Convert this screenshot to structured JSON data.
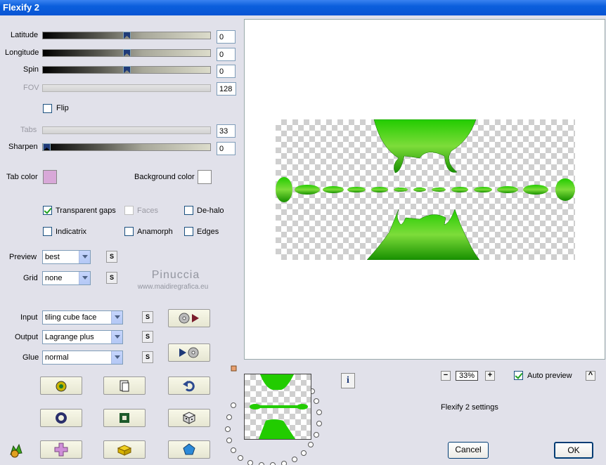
{
  "window": {
    "title": "Flexify 2"
  },
  "sliders": {
    "latitude": {
      "label": "Latitude",
      "value": "0",
      "position": 0.5
    },
    "longitude": {
      "label": "Longitude",
      "value": "0",
      "position": 0.5
    },
    "spin": {
      "label": "Spin",
      "value": "0",
      "position": 0.5
    },
    "fov": {
      "label": "FOV",
      "value": "128",
      "enabled": false
    },
    "tabs": {
      "label": "Tabs",
      "value": "33",
      "enabled": false
    },
    "sharpen": {
      "label": "Sharpen",
      "value": "0",
      "position": 0.0
    }
  },
  "flip": {
    "label": "Flip",
    "checked": false
  },
  "colors": {
    "tab_label": "Tab color",
    "tab_value": "#d8a8d8",
    "background_label": "Background color",
    "background_value": "#ffffff"
  },
  "options": {
    "transparent_gaps": {
      "label": "Transparent gaps",
      "checked": true
    },
    "faces": {
      "label": "Faces",
      "checked": false,
      "enabled": false
    },
    "dehalo": {
      "label": "De-halo",
      "checked": false
    },
    "indicatrix": {
      "label": "Indicatrix",
      "checked": false
    },
    "anamorph": {
      "label": "Anamorph",
      "checked": false
    },
    "edges": {
      "label": "Edges",
      "checked": false
    }
  },
  "preview_select": {
    "label": "Preview",
    "value": "best"
  },
  "grid_select": {
    "label": "Grid",
    "value": "none"
  },
  "input_select": {
    "label": "Input",
    "value": "tiling cube face"
  },
  "output_select": {
    "label": "Output",
    "value": "Lagrange plus"
  },
  "glue_select": {
    "label": "Glue",
    "value": "normal"
  },
  "s_button": "S",
  "watermark": {
    "name": "Pinuccia",
    "site": "www.maidiregrafica.eu"
  },
  "zoom": {
    "minus": "−",
    "value": "33%",
    "plus": "+"
  },
  "auto_preview": {
    "label": "Auto preview",
    "checked": true
  },
  "up_button": "^",
  "settings_text": "Flexify 2 settings",
  "info_button": "i",
  "buttons": {
    "cancel": "Cancel",
    "ok": "OK"
  },
  "accent": {
    "green": "#22cc00",
    "title_blue": "#0b5fdc"
  }
}
